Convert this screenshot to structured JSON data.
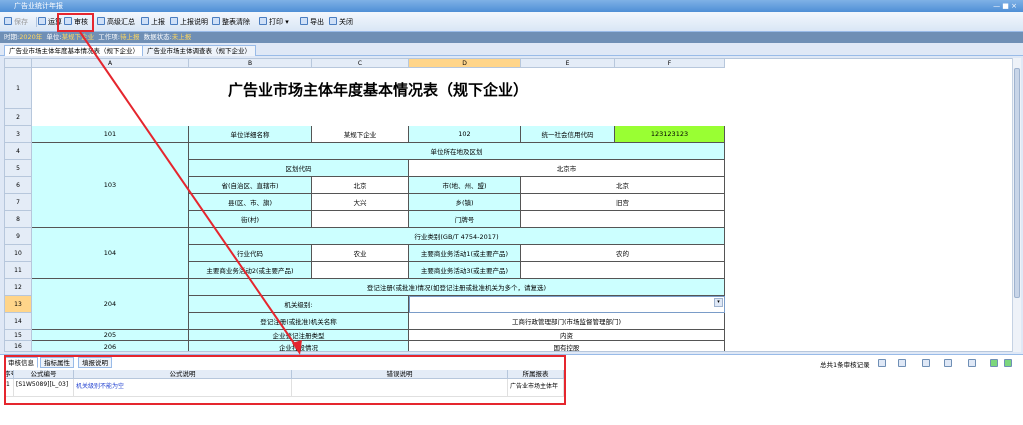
{
  "window": {
    "title": "广告业统计年报",
    "controls": "— ■ ×"
  },
  "toolbar": {
    "save": "保存",
    "run": "运算",
    "audit": "审核",
    "summary": "高级汇总",
    "report": "上报",
    "report_note": "上报说明",
    "clear": "整表清除",
    "print": "打印",
    "export": "导出",
    "close": "关闭"
  },
  "info": {
    "period_label": "时期:",
    "period_value": "2020年",
    "unit_label": "单位:",
    "unit_value": "某规下企业",
    "work_label": "工作项:",
    "work_value": "待上报",
    "data_label": "数据状态:",
    "data_value": "未上报"
  },
  "tabs": [
    "广告业市场主体年度基本情况表（规下企业）",
    "广告业市场主体调查表（规下企业）"
  ],
  "sheet": {
    "col_headers": [
      "A",
      "B",
      "C",
      "D",
      "E",
      "F"
    ],
    "row_numbers": [
      "1",
      "2",
      "3",
      "4",
      "5",
      "6",
      "7",
      "8",
      "9",
      "10",
      "11",
      "12",
      "13",
      "14",
      "15",
      "16"
    ],
    "title": "广告业市场主体年度基本情况表（规下企业）",
    "cells": {
      "r3_a": "101",
      "r3_b": "单位详细名称",
      "r3_c": "某规下企业",
      "r3_d": "102",
      "r3_e": "统一社会信用代码",
      "r3_f": "123123123",
      "r4_b": "单位所在地及区划",
      "r5_b": "区划代码",
      "r5_d": "北京市",
      "r6_a": "103",
      "r6_b": "省(自治区、直辖市)",
      "r6_c": "北京",
      "r6_d": "市(地、州、盟)",
      "r6_ef": "北京",
      "r7_b": "县(区、市、旗)",
      "r7_c": "大兴",
      "r7_d": "乡(镇)",
      "r7_ef": "旧宫",
      "r8_b": "街(村)",
      "r8_d": "门牌号",
      "r9_b": "行业类别(GB/T 4754-2017)",
      "r10_a": "104",
      "r10_b": "行业代码",
      "r10_c": "农业",
      "r10_d": "主要商业务活动1(或主要产品)",
      "r10_ef": "农的",
      "r11_b": "主要商业务活动2(或主要产品)",
      "r11_d": "主要商业务活动3(或主要产品)",
      "r12_b": "登记注册(或批准)情况(如登记注册或批准机关为多个，请复选)",
      "r13_a": "204",
      "r13_b": "机关级别:",
      "r14_b": "登记注册(或批准)机关名称",
      "r14_d": "工商行政管理部门(市场监督管理部门)",
      "r15_a": "205",
      "r15_b": "企业登记注册类型",
      "r15_d": "内资",
      "r16_a": "206",
      "r16_b": "企业控股情况",
      "r16_d": "国有控股"
    }
  },
  "bottom": {
    "tabs": [
      "审核信息",
      "指标属性",
      "填报说明"
    ],
    "status": "总共1条审核记录",
    "headers": [
      "序号",
      "公式编号",
      "公式说明",
      "错误说明",
      "所属报表"
    ],
    "rows": [
      {
        "no": "1",
        "code": "[S1W5089][L_03]",
        "desc": "机关级别不能为空",
        "error": "",
        "table": "广告业市场主体年"
      }
    ]
  }
}
